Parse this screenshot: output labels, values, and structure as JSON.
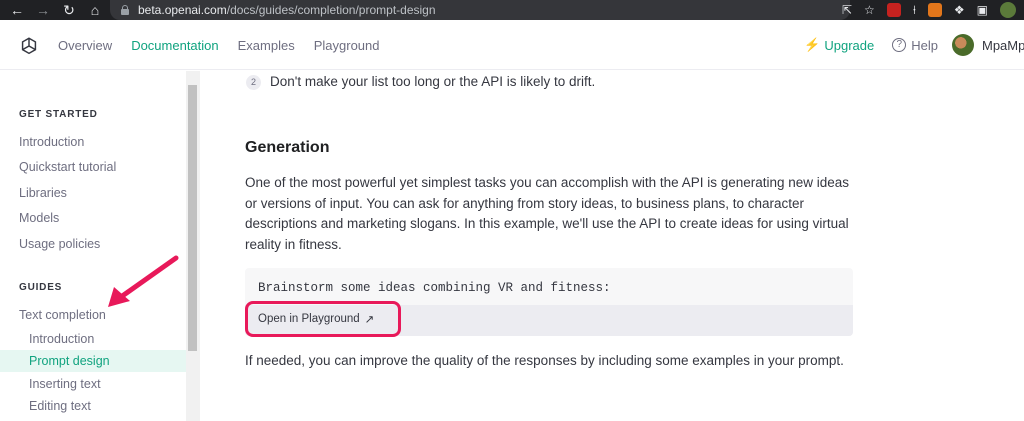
{
  "browser": {
    "url_host": "beta.openai.com",
    "url_path": "/docs/guides/completion/prompt-design"
  },
  "topnav": {
    "links": [
      {
        "label": "Overview"
      },
      {
        "label": "Documentation"
      },
      {
        "label": "Examples"
      },
      {
        "label": "Playground"
      }
    ],
    "upgrade": "Upgrade",
    "help": "Help",
    "username": "MpaMpe"
  },
  "sidebar": {
    "section1": "GET STARTED",
    "get_started": [
      "Introduction",
      "Quickstart tutorial",
      "Libraries",
      "Models",
      "Usage policies"
    ],
    "section2": "GUIDES",
    "guides_parent": "Text completion",
    "guides_children": [
      "Introduction",
      "Prompt design",
      "Inserting text",
      "Editing text"
    ]
  },
  "main": {
    "list_number": "2",
    "list_text": "Don't make your list too long or the API is likely to drift.",
    "heading": "Generation",
    "paragraph": "One of the most powerful yet simplest tasks you can accomplish with the API is generating new ideas or versions of input. You can ask for anything from story ideas, to business plans, to character descriptions and marketing slogans. In this example, we'll use the API to create ideas for using virtual reality in fitness.",
    "code": "Brainstorm some ideas combining VR and fitness:",
    "playground_button": "Open in Playground",
    "paragraph2": "If needed, you can improve the quality of the responses by including some examples in your prompt."
  },
  "colors": {
    "accent": "#10a37f",
    "annotation": "#e8195a"
  }
}
